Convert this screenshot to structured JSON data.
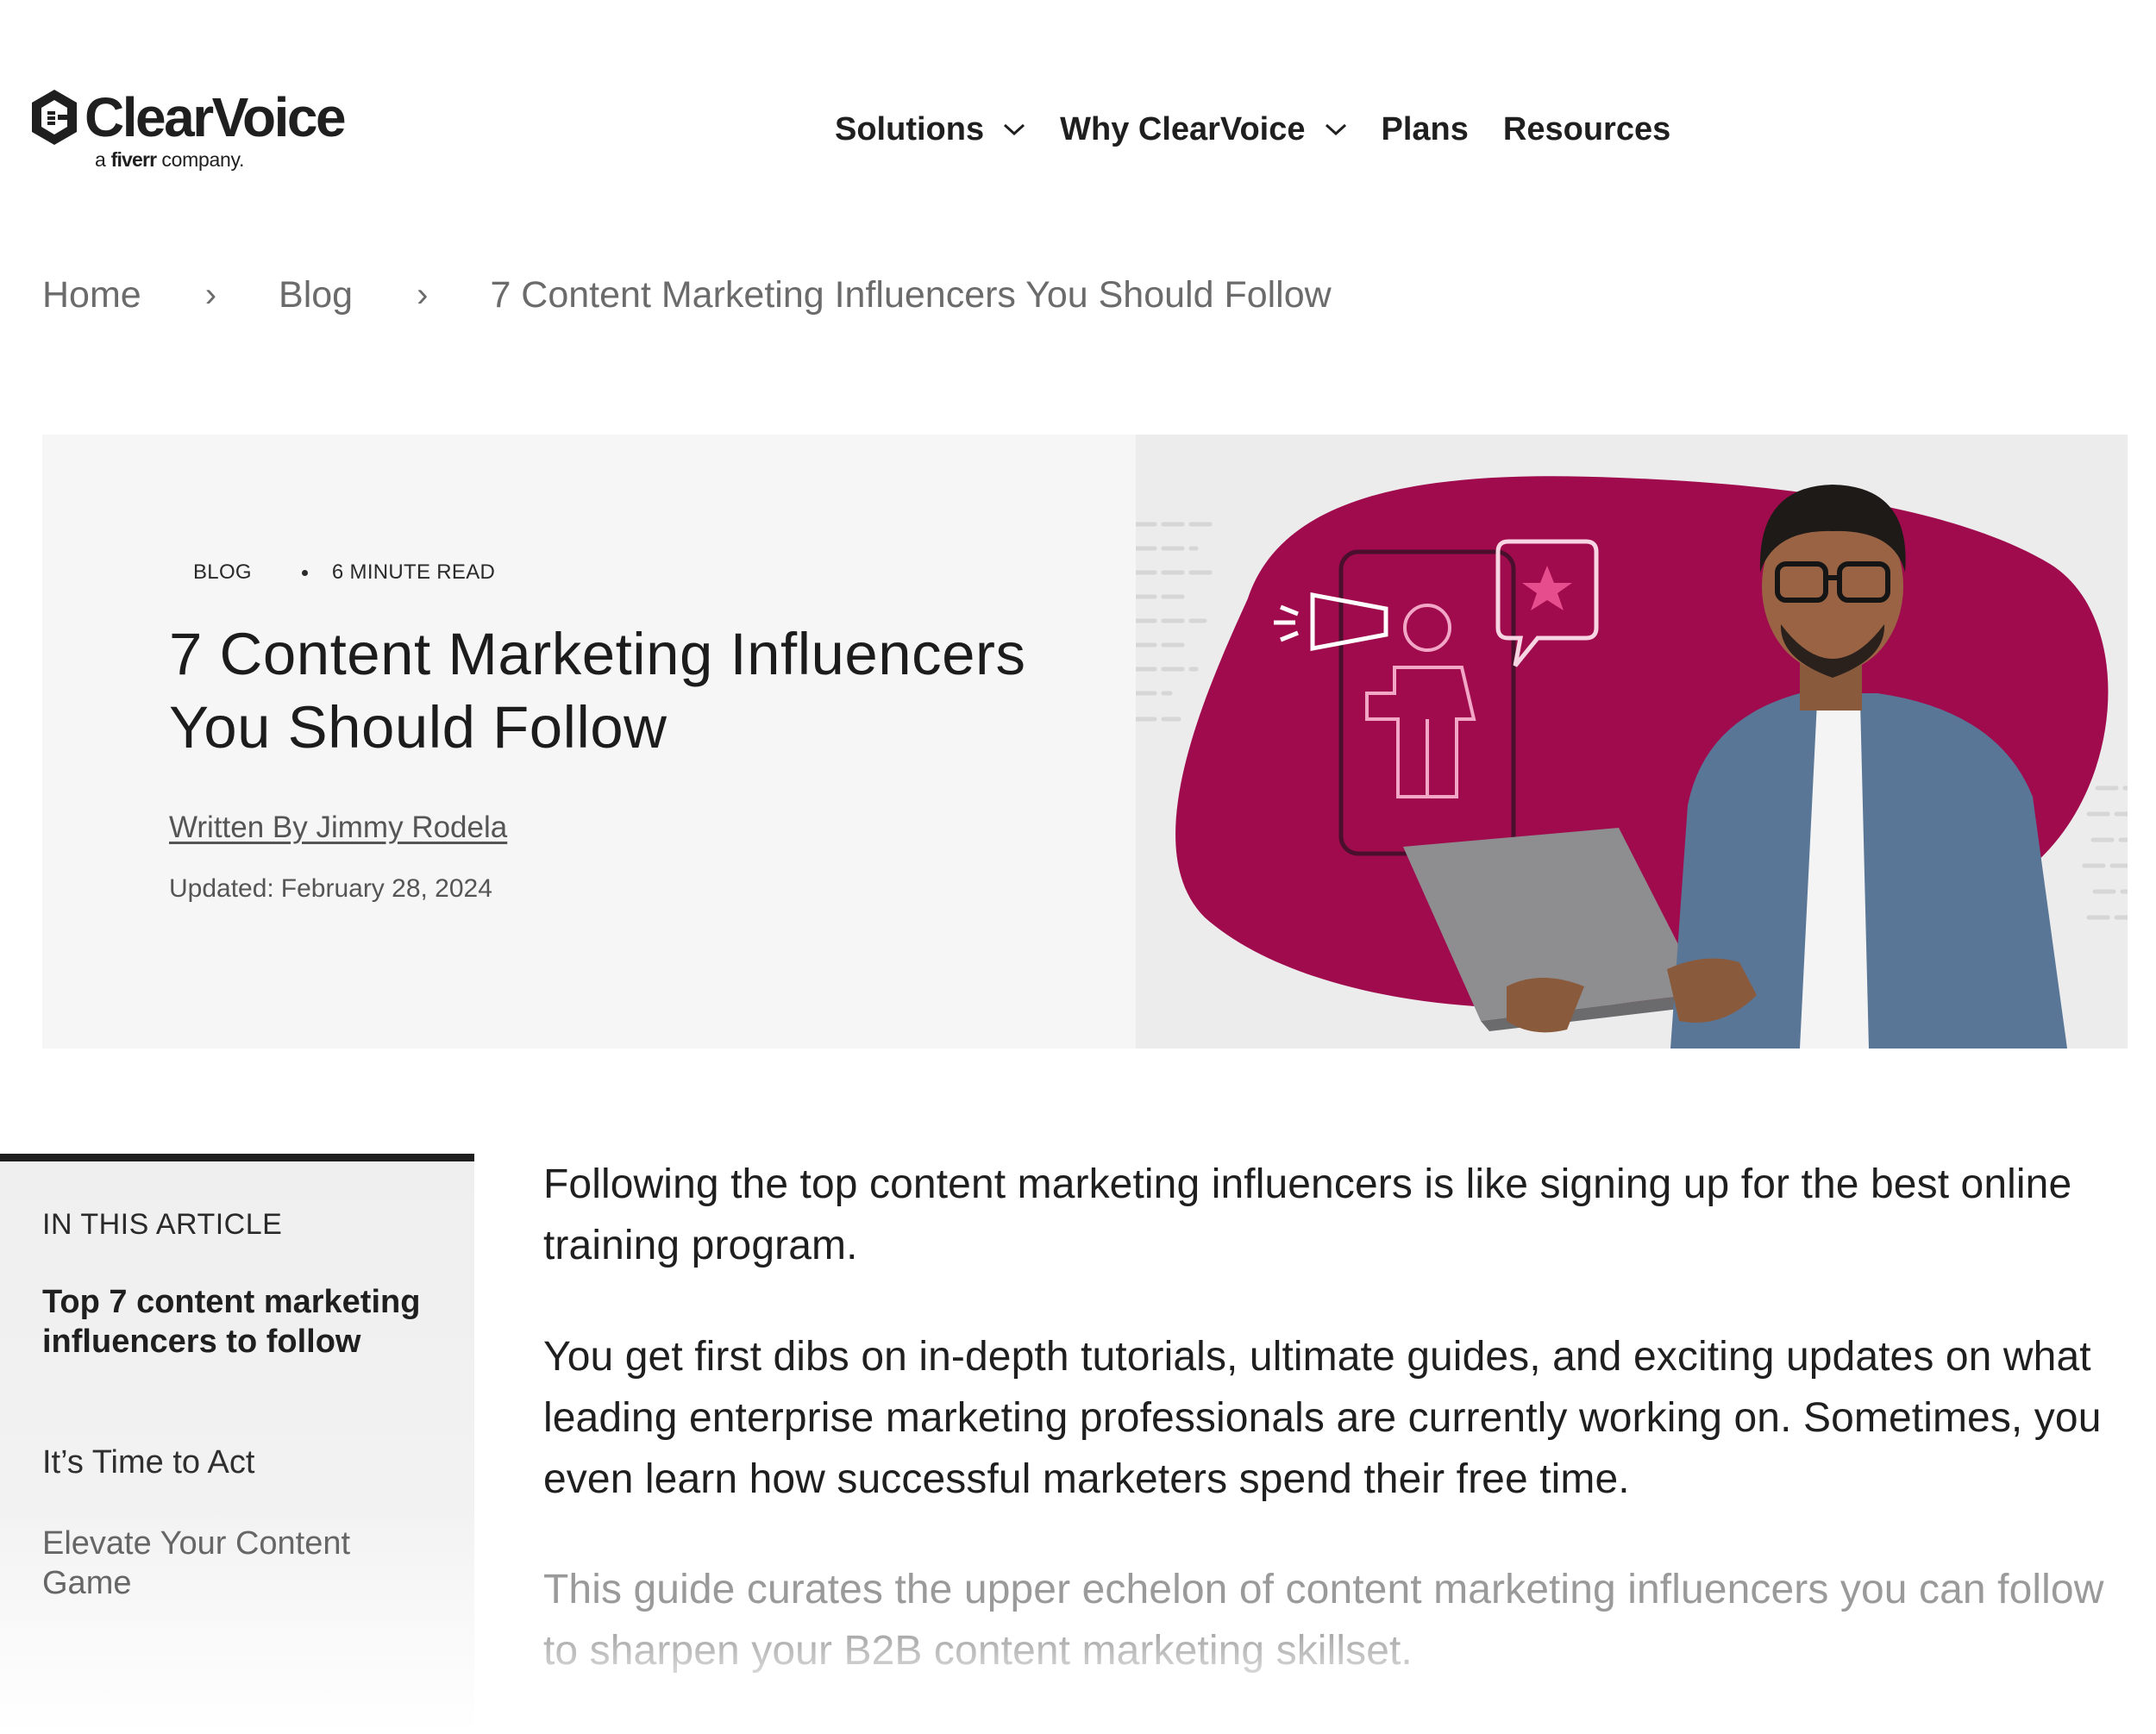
{
  "header": {
    "logo": {
      "name": "ClearVoice",
      "tagline_prefix": "a",
      "tagline_brand": "fiverr",
      "tagline_suffix": "company."
    },
    "nav": [
      {
        "label": "Solutions",
        "has_dropdown": true
      },
      {
        "label": "Why ClearVoice",
        "has_dropdown": true
      },
      {
        "label": "Plans",
        "has_dropdown": false
      },
      {
        "label": "Resources",
        "has_dropdown": false
      }
    ]
  },
  "breadcrumb": {
    "items": [
      "Home",
      "Blog",
      "7 Content Marketing Influencers You Should Follow"
    ],
    "separator": "›"
  },
  "hero": {
    "category": "BLOG",
    "read_time": "6 MINUTE READ",
    "title": "7 Content Marketing Influencers You Should Follow",
    "author": "Written By Jimmy Rodela",
    "updated_label": "Updated:",
    "updated_date": "February 28, 2024",
    "image_accent_color": "#a00b4e"
  },
  "toc": {
    "heading": "IN THIS ARTICLE",
    "items": [
      "Top 7 content marketing influencers to follow",
      "It’s Time to Act",
      "Elevate Your Content Game"
    ]
  },
  "article": {
    "paragraphs": [
      "Following the top content marketing influencers is like signing up for the best online training program.",
      "You get first dibs on in-depth tutorials, ultimate guides, and exciting updates on what leading enterprise marketing professionals are currently working on. Sometimes, you even learn how successful marketers spend their free time.",
      "This guide curates the upper echelon of content marketing influencers you can follow to sharpen your B2B content marketing skillset."
    ]
  }
}
